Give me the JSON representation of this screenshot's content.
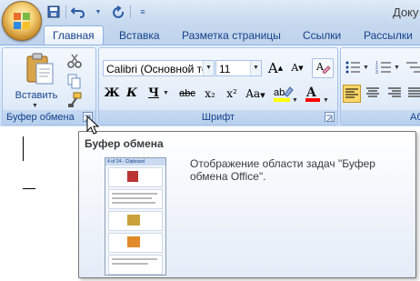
{
  "title_bar": {
    "document_title": "Доку",
    "quick_access": [
      "save-icon",
      "undo-icon",
      "redo-icon",
      "customize-qat-icon"
    ]
  },
  "tabs": [
    {
      "label": "Главная",
      "active": true
    },
    {
      "label": "Вставка",
      "active": false
    },
    {
      "label": "Разметка страницы",
      "active": false
    },
    {
      "label": "Ссылки",
      "active": false
    },
    {
      "label": "Рассылки",
      "active": false
    }
  ],
  "ribbon": {
    "clipboard": {
      "group_label": "Буфер обмена",
      "paste_label": "Вставить",
      "icons": [
        "paste-icon",
        "cut-icon",
        "copy-icon",
        "format-painter-icon"
      ]
    },
    "font": {
      "group_label": "Шрифт",
      "font_name": "Calibri (Основной те",
      "font_size": "11",
      "buttons": {
        "grow": "A",
        "shrink": "A",
        "bold": "Ж",
        "italic": "К",
        "underline": "Ч",
        "strike": "abc",
        "subscript": "x₂",
        "superscript": "x²",
        "change_case": "Aa",
        "font_color": "A"
      }
    },
    "paragraph": {
      "group_label": "Аб"
    }
  },
  "tooltip": {
    "title": "Буфер обмена",
    "description": "Отображение области задач \"Буфер обмена Office\".",
    "preview_header": "4 of 24 - Clipboard"
  },
  "colors": {
    "accent": "#15428b",
    "ribbon_bg": "#dbe7f8",
    "highlight_yellow": "#ffff00",
    "font_color_red": "#ff0000"
  }
}
